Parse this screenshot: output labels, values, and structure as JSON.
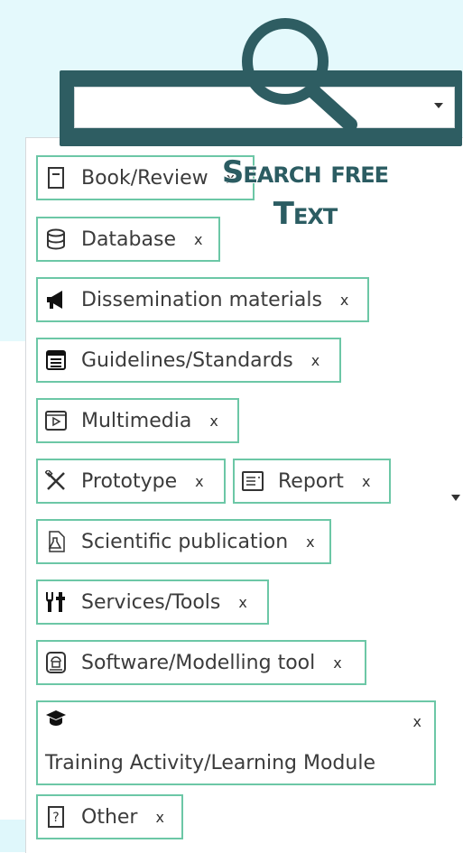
{
  "search": {
    "label": "Search free Text",
    "value": ""
  },
  "chips": [
    {
      "label": "Book/Review",
      "remove": "x",
      "icon": "book-icon"
    },
    {
      "label": "Database",
      "remove": "x",
      "icon": "database-icon"
    },
    {
      "label": "Dissemination materials",
      "remove": "x",
      "icon": "megaphone-icon"
    },
    {
      "label": "Guidelines/Standards",
      "remove": "x",
      "icon": "list-document-icon"
    },
    {
      "label": "Multimedia",
      "remove": "x",
      "icon": "media-player-icon"
    },
    {
      "label": "Prototype",
      "remove": "x",
      "icon": "tools-cross-icon"
    },
    {
      "label": "Report",
      "remove": "x",
      "icon": "report-icon"
    },
    {
      "label": "Scientific publication",
      "remove": "x",
      "icon": "flask-document-icon"
    },
    {
      "label": "Services/Tools",
      "remove": "x",
      "icon": "utensils-icon"
    },
    {
      "label": "Software/Modelling tool",
      "remove": "x",
      "icon": "software-icon"
    },
    {
      "label": "Training Activity/Learning Module",
      "remove": "x",
      "icon": "graduation-cap-icon"
    },
    {
      "label": "Other",
      "remove": "x",
      "icon": "question-icon"
    }
  ],
  "colors": {
    "chip_border": "#6cc7a6",
    "search_frame": "#2e5d62",
    "background_tint": "#e4f9fc"
  }
}
